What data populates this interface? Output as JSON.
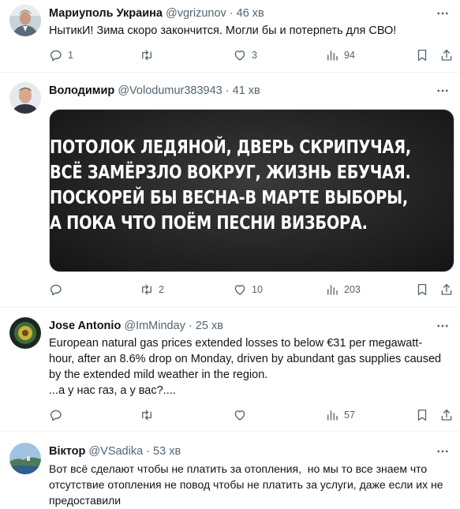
{
  "tweets": [
    {
      "name": "Мариуполь Украина",
      "handle": "@vgrizunov",
      "time": "· 46 хв",
      "text": "НытикИ! Зима скоро закончится. Могли бы и потерпеть для СВО!",
      "replies": "1",
      "retweets": "",
      "likes": "3",
      "views": "94"
    },
    {
      "name": "Володимир",
      "handle": "@Volodumur383943",
      "time": "· 41 хв",
      "image_lines": [
        "ПОТОЛОК ЛЕДЯНОЙ, ДВЕРЬ СКРИПУЧАЯ,",
        "ВСЁ ЗАМЁРЗЛО ВОКРУГ, ЖИЗНЬ ЕБУЧАЯ.",
        "ПОСКОРЕЙ БЫ ВЕСНА-В МАРТЕ ВЫБОРЫ,",
        "А ПОКА ЧТО ПОЁМ ПЕСНИ ВИЗБОРА."
      ],
      "replies": "",
      "retweets": "2",
      "likes": "10",
      "views": "203"
    },
    {
      "name": "Jose Antonio",
      "handle": "@ImMinday",
      "time": "· 25 хв",
      "text": "European natural gas prices extended losses to below €31 per megawatt-hour, after an 8.6% drop on Monday, driven by abundant gas supplies caused by the extended mild weather in the region.\n...а у нас газ, а у вас?....",
      "replies": "",
      "retweets": "",
      "likes": "",
      "views": "57"
    },
    {
      "name": "Віктор",
      "handle": "@VSadika",
      "time": "· 53 хв",
      "text": "Вот всё сделают чтобы не платить за отопления,  но мы то все знаем что отсутствие отопления не повод чтобы не платить за услуги, даже если их не предоставили"
    }
  ],
  "icons": [
    "reply-icon",
    "retweet-icon",
    "like-icon",
    "views-icon",
    "bookmark-icon",
    "share-icon",
    "more-icon"
  ]
}
